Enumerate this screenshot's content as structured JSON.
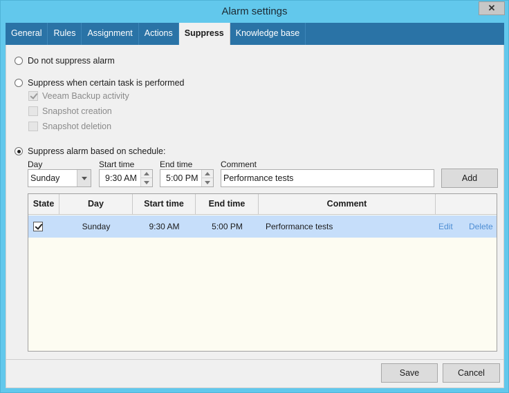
{
  "window": {
    "title": "Alarm settings",
    "close_glyph": "✕"
  },
  "tabs": [
    {
      "label": "General"
    },
    {
      "label": "Rules"
    },
    {
      "label": "Assignment"
    },
    {
      "label": "Actions"
    },
    {
      "label": "Suppress",
      "active": true
    },
    {
      "label": "Knowledge base"
    }
  ],
  "suppress": {
    "option_none": "Do not suppress alarm",
    "option_task": "Suppress when certain task is performed",
    "tasks": [
      {
        "label": "Veeam Backup activity",
        "checked": true
      },
      {
        "label": "Snapshot creation",
        "checked": false
      },
      {
        "label": "Snapshot deletion",
        "checked": false
      }
    ],
    "option_schedule": "Suppress alarm based on schedule:",
    "selected_option": "schedule"
  },
  "form": {
    "day_label": "Day",
    "day_value": "Sunday",
    "start_label": "Start time",
    "start_value": "9:30 AM",
    "end_label": "End time",
    "end_value": "5:00 PM",
    "comment_label": "Comment",
    "comment_value": "Performance tests",
    "add_label": "Add"
  },
  "table": {
    "columns": [
      "State",
      "Day",
      "Start time",
      "End time",
      "Comment"
    ],
    "rows": [
      {
        "state": true,
        "day": "Sunday",
        "start": "9:30 AM",
        "end": "5:00 PM",
        "comment": "Performance tests",
        "edit": "Edit",
        "delete": "Delete"
      }
    ]
  },
  "footer": {
    "save_label": "Save",
    "cancel_label": "Cancel"
  },
  "colors": {
    "titlebar": "#62c8ec",
    "tabbar": "#2a73a6",
    "selected_row": "#c6defa",
    "link": "#4d8dd3"
  }
}
